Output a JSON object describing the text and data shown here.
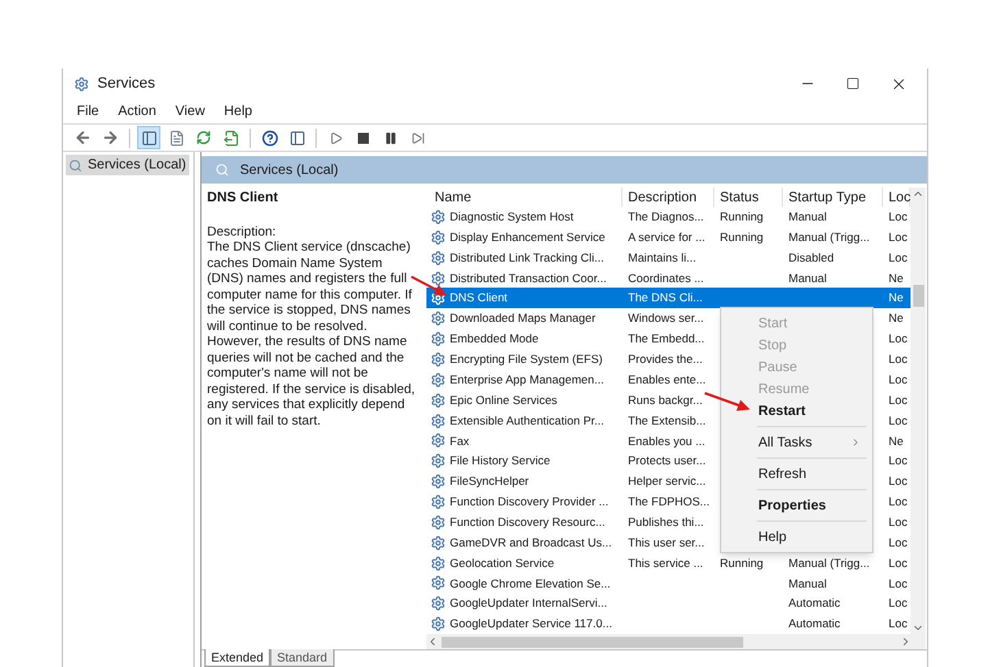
{
  "window": {
    "title": "Services"
  },
  "menu": [
    "File",
    "Action",
    "View",
    "Help"
  ],
  "tree": [
    {
      "label": "Services (Local)",
      "selected": true
    }
  ],
  "panel": {
    "title": "Services (Local)"
  },
  "details": {
    "name": "DNS Client",
    "description_label": "Description:",
    "description": "The DNS Client service (dnscache) caches Domain Name System (DNS) names and registers the full computer name for this computer. If the service is stopped, DNS names will continue to be resolved. However, the results of DNS name queries will not be cached and the computer's name will not be registered. If the service is disabled, any services that explicitly depend on it will fail to start."
  },
  "table": {
    "columns": [
      "Name",
      "Description",
      "Status",
      "Startup Type",
      "Loc"
    ],
    "rows": [
      {
        "name": "Diagnostic System Host",
        "description": "The Diagnos...",
        "status": "Running",
        "startup_type": "Manual",
        "log_on_as": "Loc",
        "selected": false
      },
      {
        "name": "Display Enhancement Service",
        "description": "A service for ...",
        "status": "Running",
        "startup_type": "Manual (Trigg...",
        "log_on_as": "Loc",
        "selected": false
      },
      {
        "name": "Distributed Link Tracking Cli...",
        "description": "Maintains li...",
        "status": "",
        "startup_type": "Disabled",
        "log_on_as": "Loc",
        "selected": false
      },
      {
        "name": "Distributed Transaction Coor...",
        "description": "Coordinates ...",
        "status": "",
        "startup_type": "Manual",
        "log_on_as": "Ne",
        "selected": false
      },
      {
        "name": "DNS Client",
        "description": "The DNS Cli...",
        "status": "",
        "startup_type": "",
        "log_on_as": "Ne",
        "selected": true
      },
      {
        "name": "Downloaded Maps Manager",
        "description": "Windows ser...",
        "status": "",
        "startup_type": "",
        "log_on_as": "Ne",
        "selected": false
      },
      {
        "name": "Embedded Mode",
        "description": "The Embedd...",
        "status": "",
        "startup_type": "",
        "log_on_as": "Loc",
        "selected": false
      },
      {
        "name": "Encrypting File System (EFS)",
        "description": "Provides the...",
        "status": "",
        "startup_type": "",
        "log_on_as": "Loc",
        "selected": false
      },
      {
        "name": "Enterprise App Managemen...",
        "description": "Enables ente...",
        "status": "",
        "startup_type": "",
        "log_on_as": "Loc",
        "selected": false
      },
      {
        "name": "Epic Online Services",
        "description": "Runs backgr...",
        "status": "",
        "startup_type": "",
        "log_on_as": "Loc",
        "selected": false
      },
      {
        "name": "Extensible Authentication Pr...",
        "description": "The Extensib...",
        "status": "",
        "startup_type": "",
        "log_on_as": "Loc",
        "selected": false
      },
      {
        "name": "Fax",
        "description": "Enables you ...",
        "status": "",
        "startup_type": "",
        "log_on_as": "Ne",
        "selected": false
      },
      {
        "name": "File History Service",
        "description": "Protects user...",
        "status": "",
        "startup_type": "",
        "log_on_as": "Loc",
        "selected": false
      },
      {
        "name": "FileSyncHelper",
        "description": "Helper servic...",
        "status": "",
        "startup_type": "",
        "log_on_as": "Loc",
        "selected": false
      },
      {
        "name": "Function Discovery Provider ...",
        "description": "The FDPHOS...",
        "status": "",
        "startup_type": "",
        "log_on_as": "Loc",
        "selected": false
      },
      {
        "name": "Function Discovery Resourc...",
        "description": "Publishes thi...",
        "status": "",
        "startup_type": "",
        "log_on_as": "Loc",
        "selected": false
      },
      {
        "name": "GameDVR and Broadcast Us...",
        "description": "This user ser...",
        "status": "",
        "startup_type": "",
        "log_on_as": "Loc",
        "selected": false
      },
      {
        "name": "Geolocation Service",
        "description": "This service ...",
        "status": "Running",
        "startup_type": "Manual (Trigg...",
        "log_on_as": "Loc",
        "selected": false
      },
      {
        "name": "Google Chrome Elevation Se...",
        "description": "",
        "status": "",
        "startup_type": "Manual",
        "log_on_as": "Loc",
        "selected": false
      },
      {
        "name": "GoogleUpdater InternalServi...",
        "description": "",
        "status": "",
        "startup_type": "Automatic",
        "log_on_as": "Loc",
        "selected": false
      },
      {
        "name": "GoogleUpdater Service 117.0...",
        "description": "",
        "status": "",
        "startup_type": "Automatic",
        "log_on_as": "Loc",
        "selected": false
      }
    ]
  },
  "context_menu": [
    {
      "kind": "item",
      "label": "Start",
      "disabled": true,
      "bold": false
    },
    {
      "kind": "item",
      "label": "Stop",
      "disabled": true,
      "bold": false
    },
    {
      "kind": "item",
      "label": "Pause",
      "disabled": true,
      "bold": false
    },
    {
      "kind": "item",
      "label": "Resume",
      "disabled": true,
      "bold": false
    },
    {
      "kind": "item",
      "label": "Restart",
      "disabled": false,
      "bold": true
    },
    {
      "kind": "separator"
    },
    {
      "kind": "submenu",
      "label": "All Tasks",
      "disabled": false,
      "bold": false
    },
    {
      "kind": "separator"
    },
    {
      "kind": "item",
      "label": "Refresh",
      "disabled": false,
      "bold": false
    },
    {
      "kind": "separator"
    },
    {
      "kind": "item",
      "label": "Properties",
      "disabled": false,
      "bold": true
    },
    {
      "kind": "separator"
    },
    {
      "kind": "item",
      "label": "Help",
      "disabled": false,
      "bold": false
    }
  ],
  "tabs": [
    {
      "label": "Extended",
      "selected": true
    },
    {
      "label": "Standard",
      "selected": false
    }
  ]
}
